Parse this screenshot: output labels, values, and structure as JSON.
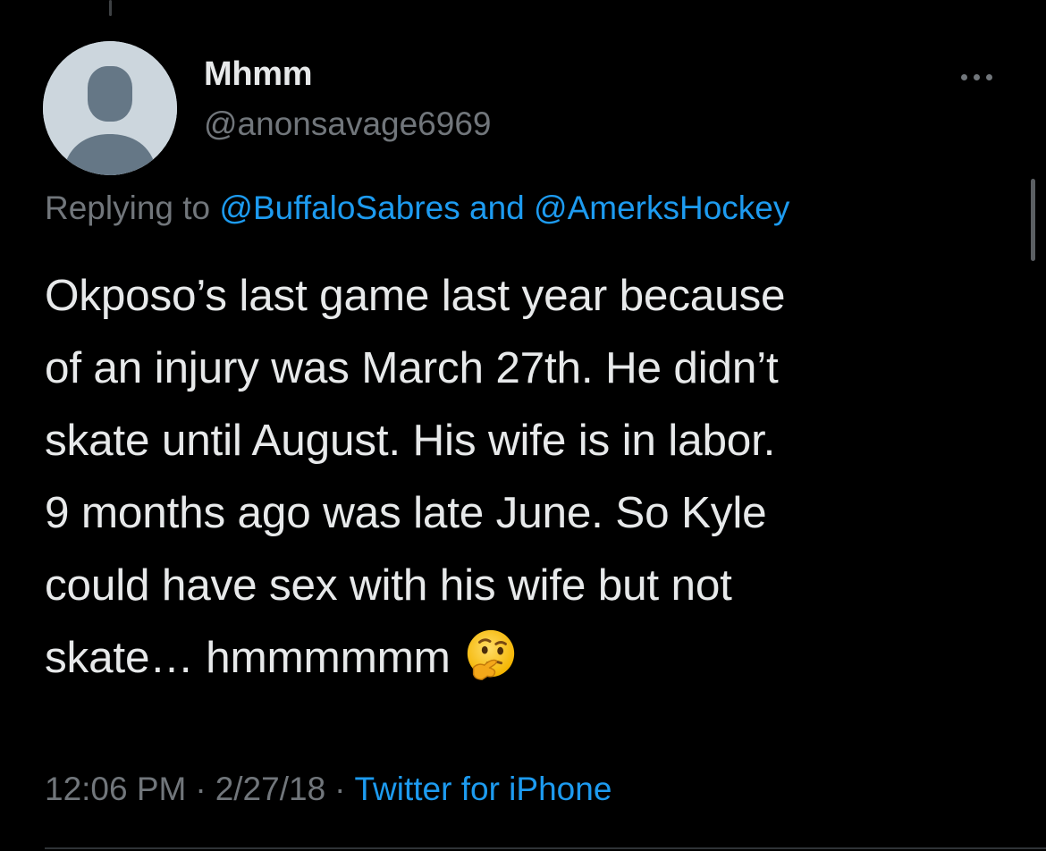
{
  "tweet": {
    "display_name": "Mhmm",
    "handle": "@anonsavage6969",
    "replying_prefix": "Replying to",
    "reply_to_1": "@BuffaloSabres",
    "reply_joiner": "and",
    "reply_to_2": "@AmerksHockey",
    "body_lines": [
      "Okposo’s last game last year because",
      "of an injury was March 27th. He didn’t",
      "skate until August. His wife is in labor.",
      "9 months ago was late June. So Kyle",
      "could have sex with his wife but not",
      "skate… hmmmmmm"
    ],
    "emoji": "thinking-face",
    "time": "12:06 PM",
    "separator": "·",
    "date": "2/27/18",
    "source": "Twitter for iPhone"
  },
  "icons": {
    "avatar": "default-profile-avatar",
    "more": "more-options-icon"
  },
  "colors": {
    "background": "#000000",
    "text_primary": "#e7e9ea",
    "text_secondary": "#71767b",
    "link": "#1d9bf0",
    "avatar_bg": "#ccd6dd",
    "avatar_fg": "#657786"
  }
}
